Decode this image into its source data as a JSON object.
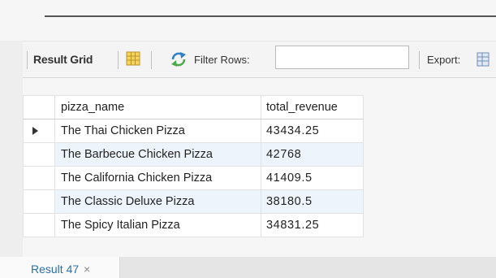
{
  "toolbar": {
    "result_grid_label": "Result Grid",
    "filter_label": "Filter Rows:",
    "filter_value": "",
    "export_label": "Export:"
  },
  "grid": {
    "columns": [
      "pizza_name",
      "total_revenue"
    ],
    "rows": [
      {
        "pizza_name": "The Thai Chicken Pizza",
        "total_revenue": "43434.25"
      },
      {
        "pizza_name": "The Barbecue Chicken Pizza",
        "total_revenue": "42768"
      },
      {
        "pizza_name": "The California Chicken Pizza",
        "total_revenue": "41409.5"
      },
      {
        "pizza_name": "The Classic Deluxe Pizza",
        "total_revenue": "38180.5"
      },
      {
        "pizza_name": "The Spicy Italian Pizza",
        "total_revenue": "34831.25"
      }
    ],
    "current_row_index": 0
  },
  "tabs": {
    "result_tab_label": "Result 47",
    "close_glyph": "×"
  },
  "icons": {
    "grid_view": "grid-view-icon",
    "refresh": "refresh-icon",
    "export": "export-icon",
    "row_pointer": "row-pointer-icon"
  },
  "colors": {
    "alt_row": "#eef4fc",
    "tab_text": "#2b6ea8",
    "toolbar_bg": "#f4f4f4"
  }
}
